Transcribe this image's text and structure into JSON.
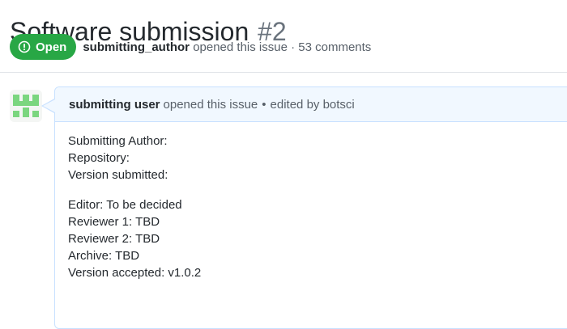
{
  "issue": {
    "title": "Software submission",
    "number": "#2",
    "state": "Open",
    "author": "submitting_author",
    "opened_text": "opened this issue · 53 comments"
  },
  "comment": {
    "author": "submitting user",
    "opened_text": "opened this issue",
    "edited_text": "edited by botsci",
    "body": {
      "submitting_author": "Submitting Author:",
      "repository": "Repository:",
      "version_submitted": "Version submitted:",
      "editor": "Editor: To be decided",
      "reviewer1": "Reviewer 1: TBD",
      "reviewer2": "Reviewer 2: TBD",
      "archive": "Archive: TBD",
      "version_accepted": "Version accepted: v1.0.2"
    }
  },
  "colors": {
    "open_green": "#28a745",
    "header_blue": "#f1f8ff",
    "border_blue": "#c8e1ff",
    "avatar_green": "#7bd67f"
  },
  "icons": {
    "state_icon": "issue-opened-icon",
    "avatar": "identicon-avatar"
  }
}
